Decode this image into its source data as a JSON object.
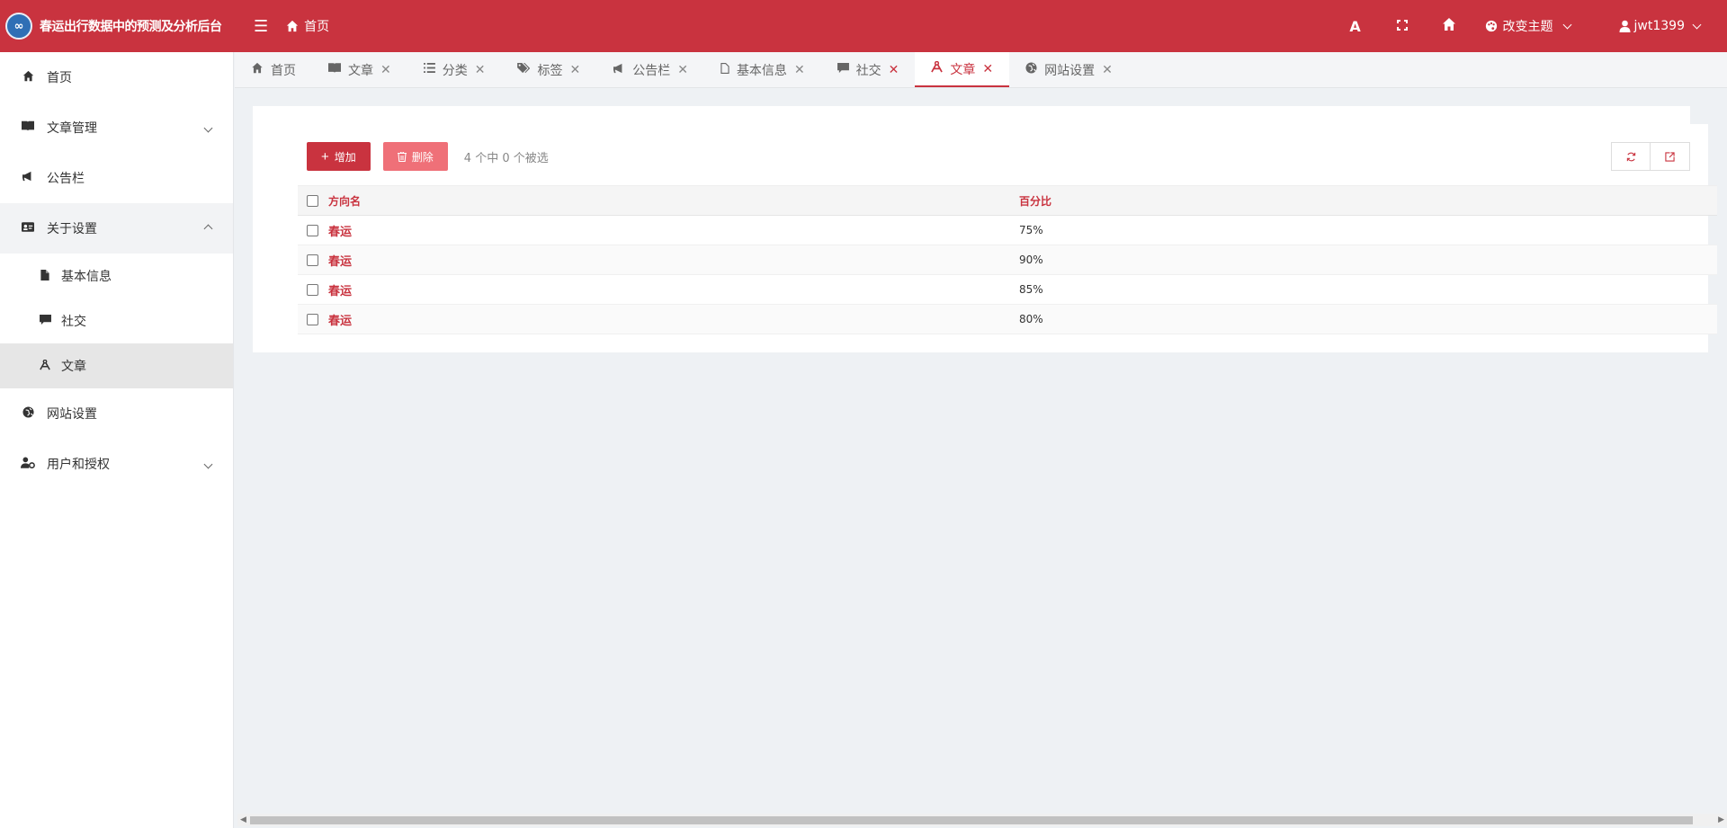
{
  "header": {
    "logo_text": "∞",
    "title": "春运出行数据中的预测及分析后台",
    "home_label": "首页",
    "theme_label": "改变主题",
    "username": "jwt1399"
  },
  "sidebar": {
    "items": [
      {
        "label": "首页",
        "icon": "home-icon"
      },
      {
        "label": "文章管理",
        "icon": "book-icon"
      },
      {
        "label": "公告栏",
        "icon": "bullhorn-icon"
      },
      {
        "label": "关于设置",
        "icon": "id-card-icon"
      },
      {
        "label": "网站设置",
        "icon": "globe-icon"
      },
      {
        "label": "用户和授权",
        "icon": "user-cog-icon"
      }
    ],
    "sub_items": [
      {
        "label": "基本信息",
        "icon": "file-icon"
      },
      {
        "label": "社交",
        "icon": "comment-icon"
      },
      {
        "label": "文章",
        "icon": "compass-icon"
      }
    ]
  },
  "tabs": [
    {
      "label": "首页",
      "icon": "home-icon",
      "closable": false
    },
    {
      "label": "文章",
      "icon": "book-icon",
      "closable": true
    },
    {
      "label": "分类",
      "icon": "list-icon",
      "closable": true
    },
    {
      "label": "标签",
      "icon": "tags-icon",
      "closable": true
    },
    {
      "label": "公告栏",
      "icon": "bullhorn-icon",
      "closable": true
    },
    {
      "label": "基本信息",
      "icon": "file-icon",
      "closable": true
    },
    {
      "label": "社交",
      "icon": "comment-icon",
      "closable": true
    },
    {
      "label": "文章",
      "icon": "compass-icon",
      "closable": true,
      "active": true
    },
    {
      "label": "网站设置",
      "icon": "globe-icon",
      "closable": true
    }
  ],
  "toolbar": {
    "add_label": "增加",
    "delete_label": "删除",
    "selection_info": "4 个中 0 个被选"
  },
  "table": {
    "headers": {
      "name": "方向名",
      "percent": "百分比"
    },
    "rows": [
      {
        "name": "春运",
        "percent": "75%"
      },
      {
        "name": "春运",
        "percent": "90%"
      },
      {
        "name": "春运",
        "percent": "85%"
      },
      {
        "name": "春运",
        "percent": "80%"
      }
    ]
  },
  "colors": {
    "accent": "#c9333f",
    "delete_button": "#ef7078",
    "background": "#eef1f4"
  }
}
